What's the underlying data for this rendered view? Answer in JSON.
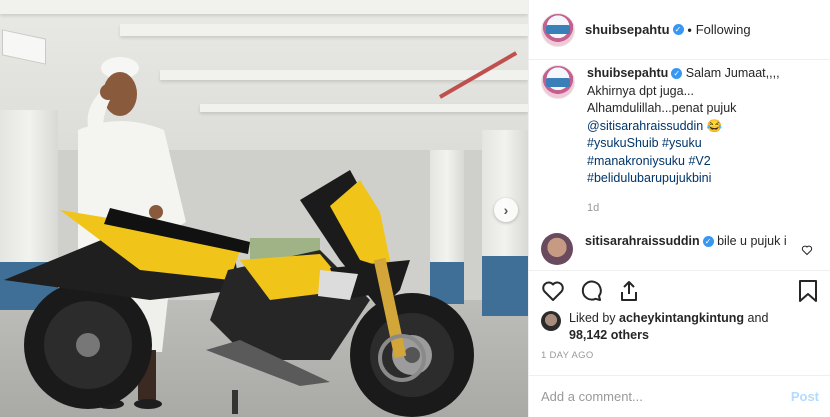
{
  "post": {
    "author": "shuibsepahtu",
    "follow_state": "Following",
    "separator": "•"
  },
  "caption": {
    "user": "shuibsepahtu",
    "line1": "Salam Jumaat,,,,",
    "line2": "Akhirnya dpt juga...",
    "line3": "Alhamdulillah...penat pujuk",
    "mention": "@sitisarahraissuddin 😂",
    "tags_line1": "#ysukuShuib #ysuku",
    "tags_line2": "#manakroniysuku #V2",
    "tags_line3": "#belidulubarupujukbini",
    "time_ago": "1d"
  },
  "reply": {
    "user": "sitisarahraissuddin",
    "text": "bile u pujuk i"
  },
  "likes": {
    "prefix": "Liked by ",
    "user": "acheykintangkintung",
    "connector": " and",
    "count": "98,142 others"
  },
  "date": "1 DAY AGO",
  "add_comment": {
    "placeholder": "Add a comment...",
    "post_label": "Post"
  },
  "icons": {
    "verified": "verified-badge-icon",
    "like": "heart-icon",
    "comment": "comment-icon",
    "share": "share-icon",
    "save": "bookmark-icon",
    "next": "chevron-right-icon"
  },
  "colors": {
    "verified": "#3897f0",
    "hashtag": "#003569",
    "muted": "#999999",
    "post_button": "#b3dbff"
  }
}
